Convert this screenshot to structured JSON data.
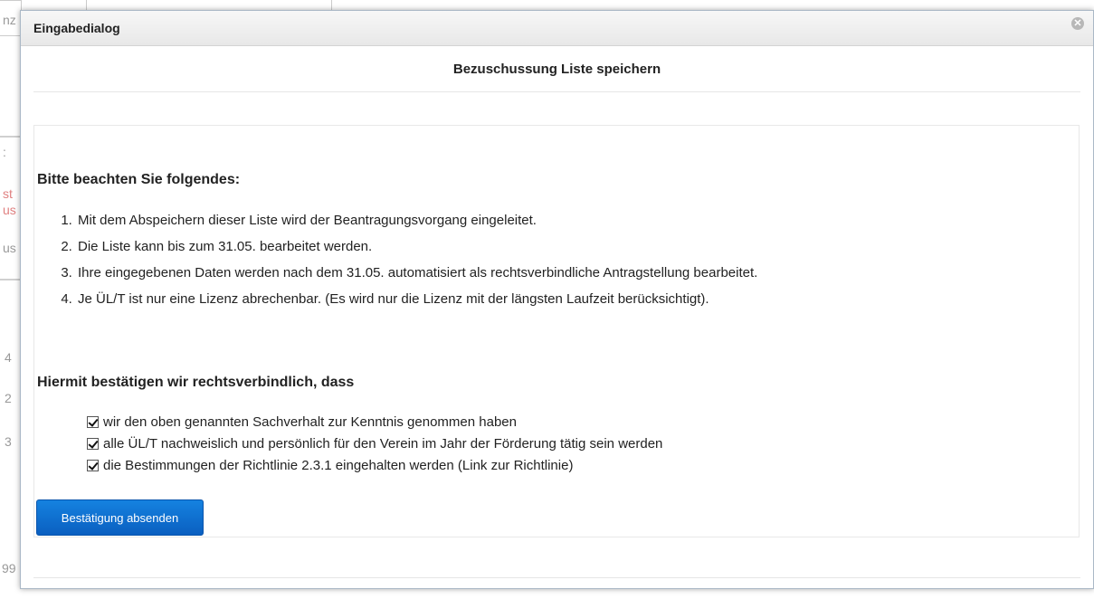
{
  "background": {
    "fragments": [
      "nz",
      ":",
      "st",
      "us",
      "us",
      "4",
      "2",
      "3",
      "99"
    ]
  },
  "dialog": {
    "title": "Eingabedialog",
    "close_icon": "close-circle-icon",
    "subtitle": "Bezuschussung Liste speichern",
    "notice_heading": "Bitte beachten Sie folgendes:",
    "notice_items": [
      "Mit dem Abspeichern dieser Liste wird der Beantragungsvorgang eingeleitet.",
      "Die Liste kann bis zum 31.05. bearbeitet werden.",
      "Ihre eingegebenen Daten werden nach dem 31.05. automatisiert als rechtsverbindliche Antragstellung bearbeitet.",
      "Je ÜL/T ist nur eine Lizenz abrechenbar. (Es wird nur die Lizenz mit der längsten Laufzeit berücksichtigt)."
    ],
    "confirm_heading": "Hiermit bestätigen wir rechtsverbindlich, dass",
    "checkboxes": [
      {
        "label": "wir den oben genannten Sachverhalt zur Kenntnis genommen haben",
        "checked": true
      },
      {
        "label": "alle ÜL/T nachweislich und persönlich für den Verein im Jahr der Förderung tätig sein werden",
        "checked": true
      },
      {
        "label": "die Bestimmungen der Richtlinie 2.3.1 eingehalten werden (Link zur Richtlinie)",
        "checked": true
      }
    ],
    "submit_label": "Bestätigung absenden",
    "accent_color": "#0b6fd3"
  }
}
